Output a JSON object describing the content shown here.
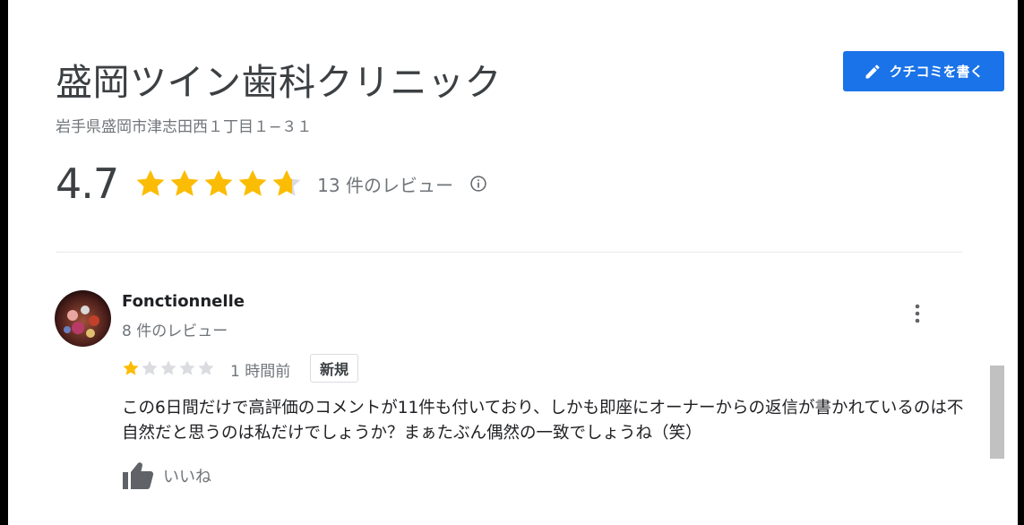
{
  "place": {
    "title": "盛岡ツイン歯科クリニック",
    "address": "岩手県盛岡市津志田西１丁目１−３１"
  },
  "write_review_button": {
    "label": "クチコミを書く",
    "icon": "pencil-icon",
    "color": "#1a73e8"
  },
  "rating": {
    "score": "4.7",
    "stars_value": 4.7,
    "stars_max": 5,
    "review_count": "13 件のレビュー",
    "info_icon": "info-icon",
    "star_color": "#fbbc04"
  },
  "review": {
    "author": "Fonctionnelle",
    "author_review_count": "8 件のレビュー",
    "stars": 1,
    "stars_max": 5,
    "time": "1 時間前",
    "badge": "新規",
    "text": "この6日間だけで高評価のコメントが11件も付いており、しかも即座にオーナーからの返信が書かれているのは不自然だと思うのは私だけでしょうか？まぁたぶん偶然の一致でしょうね（笑）",
    "like_label": "いいね",
    "like_icon": "thumbs-up-icon",
    "menu_icon": "more-vert-icon"
  }
}
